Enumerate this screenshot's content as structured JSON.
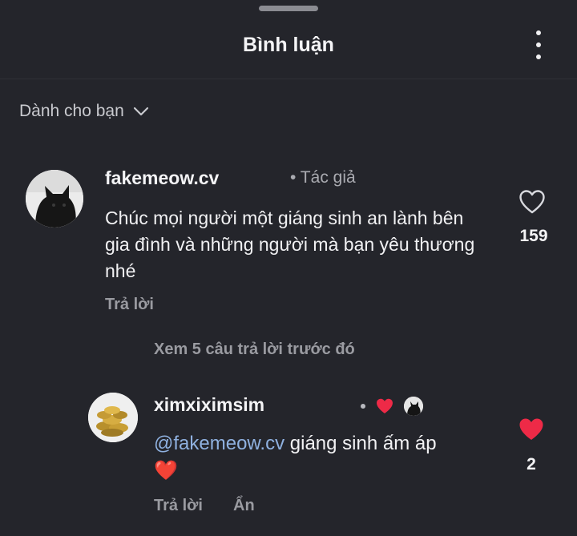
{
  "header": {
    "title": "Bình luận"
  },
  "filter": {
    "label": "Dành cho bạn"
  },
  "comment": {
    "username": "fakemeow.cv",
    "badge": "• Tác giả",
    "text": "Chúc mọi người một giáng sinh an lành bên gia đình và những người mà bạn yêu thương nhé",
    "reply_label": "Trả lời",
    "like_count": "159",
    "liked": false
  },
  "view_replies": {
    "label": "Xem 5 câu trả lời trước đó"
  },
  "reply": {
    "username": "ximxiximsim",
    "mention": "@fakemeow.cv",
    "text": " giáng sinh ấm áp",
    "emoji": "❤️",
    "reply_label": "Trả lời",
    "hide_label": "Ẩn",
    "like_count": "2",
    "liked": true
  },
  "colors": {
    "background": "#24252b",
    "like_red": "#ee2a47",
    "mention_blue": "#8fb1e0"
  }
}
